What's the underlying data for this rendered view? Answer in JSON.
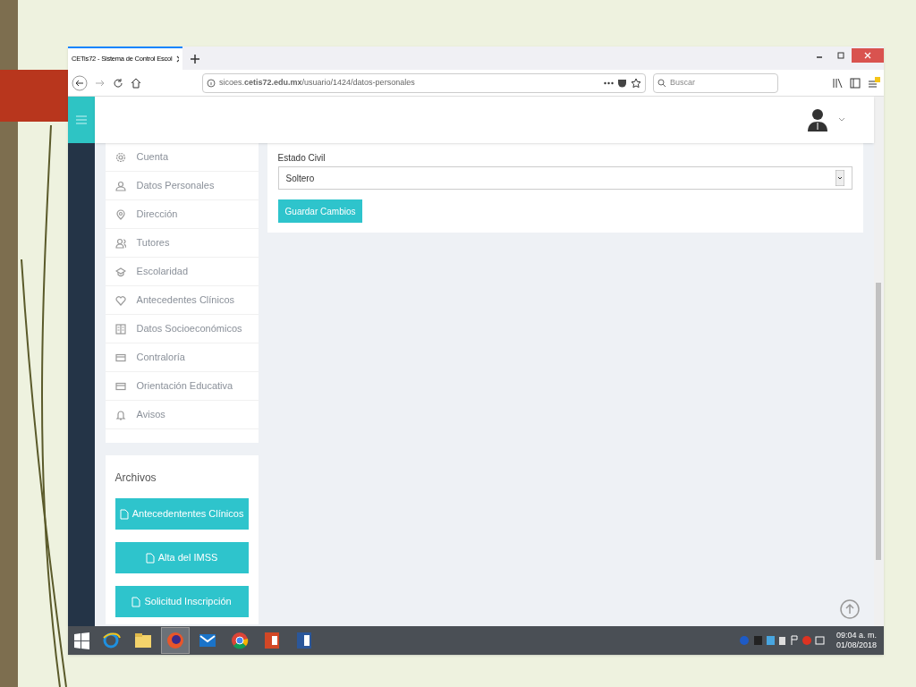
{
  "browser": {
    "tab_title": "CETis72 - Sistema de Control Escol",
    "url": "sicoes.**cetis72.edu.mx**/usuario/1424/datos-personales",
    "search": {
      "placeholder": "Buscar"
    }
  },
  "sidebar": {
    "items": [
      {
        "label": "Cuenta",
        "kind": "gear"
      },
      {
        "label": "Datos Personales",
        "kind": "person"
      },
      {
        "label": "Dirección",
        "kind": "pin"
      },
      {
        "label": "Tutores",
        "kind": "people"
      },
      {
        "label": "Escolaridad",
        "kind": "cap"
      },
      {
        "label": "Antecedentes Clínicos",
        "kind": "heart"
      },
      {
        "label": "Datos Socioeconómicos",
        "kind": "book"
      },
      {
        "label": "Contraloría",
        "kind": "card"
      },
      {
        "label": "Orientación Educativa",
        "kind": "card"
      },
      {
        "label": "Avisos",
        "kind": "bell"
      }
    ]
  },
  "archivos": {
    "title": "Archivos",
    "buttons": [
      "Antecedententes Clínicos",
      "Alta del IMSS",
      "Solicitud Inscripción"
    ]
  },
  "form": {
    "label": "Estado Civil",
    "value": "Soltero",
    "button": "Guardar Cambios"
  },
  "taskbar": {
    "apps": [
      {
        "kind": "ie",
        "selected": false
      },
      {
        "kind": "files",
        "selected": false
      },
      {
        "kind": "firefox",
        "selected": true
      },
      {
        "kind": "mail",
        "selected": false
      },
      {
        "kind": "chrome",
        "selected": false
      },
      {
        "kind": "powerpoint",
        "selected": false
      },
      {
        "kind": "word",
        "selected": false
      }
    ],
    "time": "09:04 a. m.",
    "date": "01/08/2018"
  }
}
